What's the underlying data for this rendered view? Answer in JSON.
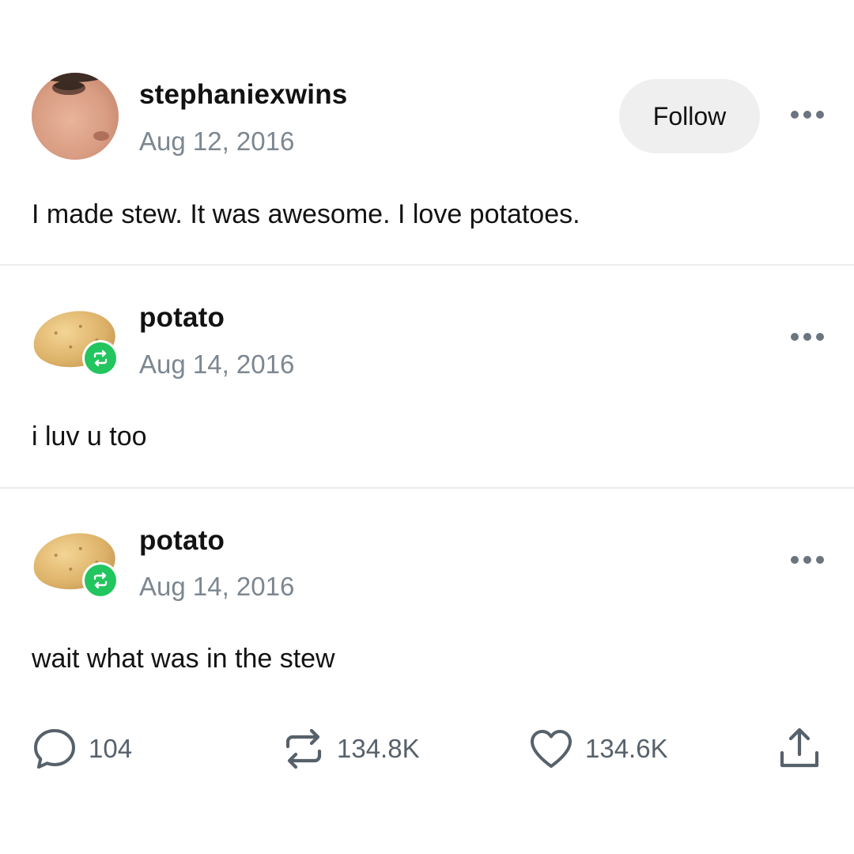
{
  "posts": [
    {
      "username": "stephaniexwins",
      "date": "Aug 12, 2016",
      "text": "I made stew. It was awesome. I love potatoes.",
      "follow_label": "Follow"
    },
    {
      "username": "potato",
      "date": "Aug 14, 2016",
      "text": "i luv u too"
    },
    {
      "username": "potato",
      "date": "Aug 14, 2016",
      "text": "wait what was in the stew"
    }
  ],
  "footer": {
    "comments": "104",
    "reblogs": "134.8K",
    "likes": "134.6K"
  },
  "colors": {
    "reblog_badge": "#22c55e",
    "muted_text": "#7d8791",
    "icon_gray": "#57616b"
  }
}
